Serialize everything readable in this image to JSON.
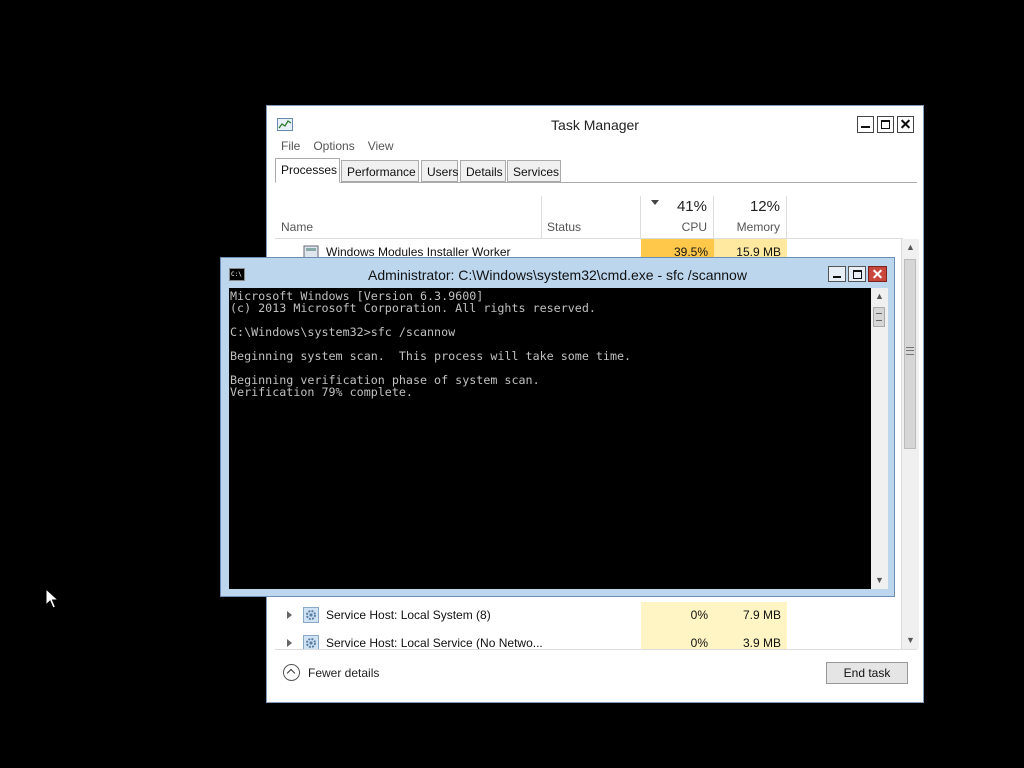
{
  "task_manager": {
    "title": "Task Manager",
    "menu": [
      "File",
      "Options",
      "View"
    ],
    "tabs": [
      "Processes",
      "Performance",
      "Users",
      "Details",
      "Services"
    ],
    "columns": {
      "name": "Name",
      "status": "Status",
      "cpu_percent": "41%",
      "cpu_label": "CPU",
      "memory_percent": "12%",
      "memory_label": "Memory"
    },
    "rows": [
      {
        "name": "Windows Modules Installer Worker",
        "cpu": "39.5%",
        "memory": "15.9 MB"
      },
      {
        "name": "Service Host: Local System (8)",
        "cpu": "0%",
        "memory": "7.9 MB"
      },
      {
        "name": "Service Host: Local Service (No Netwo...",
        "cpu": "0%",
        "memory": "3.9 MB"
      }
    ],
    "footer": {
      "fewer_details": "Fewer details",
      "end_task": "End task"
    }
  },
  "cmd": {
    "title": "Administrator: C:\\Windows\\system32\\cmd.exe - sfc  /scannow",
    "icon_text": "C:\\",
    "output": "Microsoft Windows [Version 6.3.9600]\n(c) 2013 Microsoft Corporation. All rights reserved.\n\nC:\\Windows\\system32>sfc /scannow\n\nBeginning system scan.  This process will take some time.\n\nBeginning verification phase of system scan.\nVerification 79% complete."
  }
}
